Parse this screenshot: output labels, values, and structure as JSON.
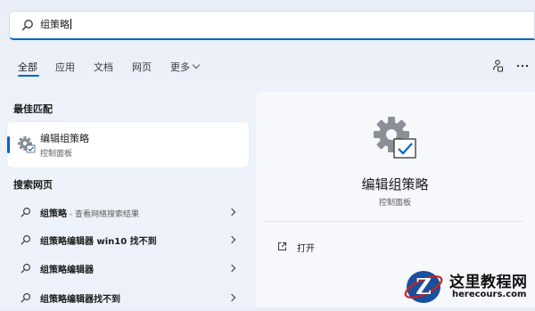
{
  "search": {
    "value": "组策略",
    "icon": "search-icon"
  },
  "tabs": [
    {
      "label": "全部",
      "active": true
    },
    {
      "label": "应用"
    },
    {
      "label": "文档"
    },
    {
      "label": "网页"
    },
    {
      "label": "更多"
    }
  ],
  "toolbar": {
    "share_icon": "account-share-icon",
    "more_icon": "more-dots-icon"
  },
  "best_match": {
    "heading": "最佳匹配",
    "title": "编辑组策略",
    "subtitle": "控制面板",
    "icon": "control-panel-settings-icon"
  },
  "web_search": {
    "heading": "搜索网页",
    "rows": [
      {
        "bold": "组策略",
        "suffix": " - 查看网络搜索结果"
      },
      {
        "bold": "组策略编辑器 win10 找不到",
        "suffix": ""
      },
      {
        "bold": "组策略编辑器",
        "suffix": ""
      },
      {
        "bold": "组策略编辑器找不到",
        "suffix": ""
      }
    ]
  },
  "preview": {
    "title": "编辑组策略",
    "subtitle": "控制面板",
    "open_label": "打开"
  },
  "watermark": {
    "name": "这里教程网",
    "url": "herecours.com",
    "logo_letter": "Z"
  },
  "colors": {
    "accent": "#0067c0",
    "background": "#eef2fa",
    "card": "#ffffff"
  }
}
